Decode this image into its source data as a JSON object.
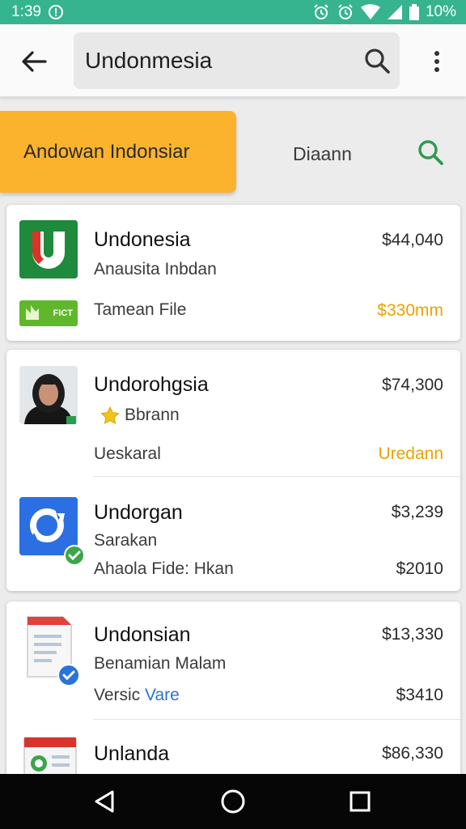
{
  "status_bar": {
    "time": "1:39",
    "battery": "10%",
    "background": "#35b48f"
  },
  "app_bar": {
    "search": {
      "value": "Undonmesia",
      "placeholder": ""
    }
  },
  "tabs": [
    {
      "label": "Andowan Indonsiar",
      "active": true,
      "color": "#fbb32e"
    },
    {
      "label": "Diaann",
      "active": false
    }
  ],
  "results": [
    {
      "title": "Undonesia",
      "subtitle": "Anausita Inbdan",
      "meta": "Tamean File",
      "badge": "FICT",
      "price": "$44,040",
      "price2": "$330mm",
      "icon": "u-logo-icon"
    },
    {
      "title": "Undorohgsia",
      "subtitle": "Bbrann",
      "meta": "Ueskaral",
      "price": "$74,300",
      "price2": "Uredann",
      "icon": "profile-photo-icon"
    },
    {
      "title": "Undorgan",
      "subtitle": "Sarakan",
      "meta": "Ahaola Fide: Hkan",
      "price": "$3,239",
      "price2": "$2010",
      "icon": "sync-icon"
    },
    {
      "title": "Undonsian",
      "subtitle": "Benamian Malam",
      "meta_a": "Versic",
      "meta_b": "Vare",
      "price": "$13,330",
      "price2": "$3410",
      "icon": "document-icon"
    },
    {
      "title": "Unlanda",
      "price": "$86,330",
      "icon": "document-card-icon"
    }
  ],
  "colors": {
    "accent_yellow": "#fbb32e",
    "price_accent": "#e9a300",
    "link_blue": "#2a73d8",
    "search_green": "#2e9b4f"
  }
}
